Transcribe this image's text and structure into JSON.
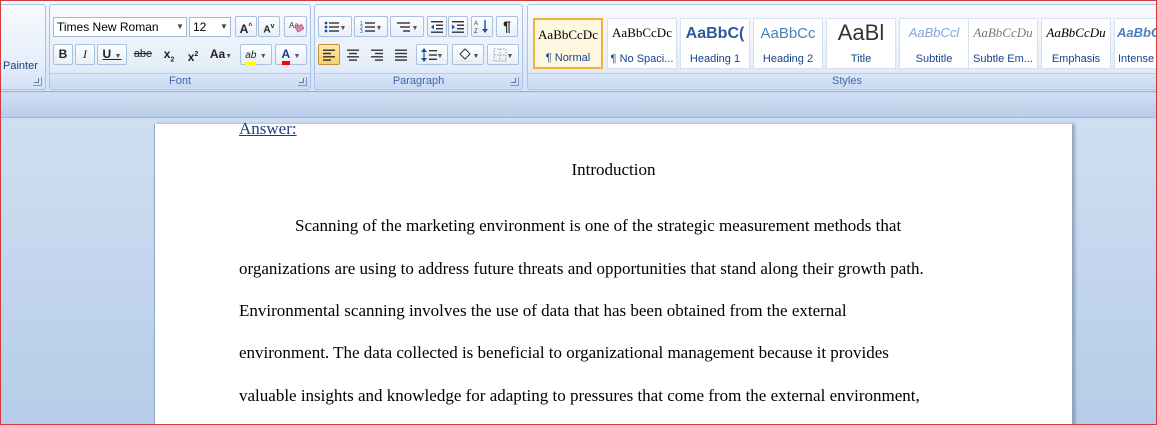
{
  "ribbon": {
    "clipboard": {
      "painter_label": "Painter"
    },
    "font": {
      "group_label": "Font",
      "font_name": "Times New Roman",
      "font_size": "12",
      "grow_label": "A",
      "shrink_label": "A",
      "bold_label": "B",
      "italic_label": "I",
      "underline_label": "U",
      "strike_label": "abe",
      "subscript_label": "x",
      "superscript_label": "x",
      "case_label": "Aa",
      "highlight_label": "ab",
      "fontcolor_label": "A",
      "highlight_color": "#ffff00",
      "fontcolor_color": "#ff0000"
    },
    "paragraph": {
      "group_label": "Paragraph"
    },
    "styles": {
      "group_label": "Styles",
      "items": [
        {
          "sample": "AaBbCcDc",
          "name": "¶ Normal"
        },
        {
          "sample": "AaBbCcDc",
          "name": "¶ No Spaci..."
        },
        {
          "sample": "AaBbC(",
          "name": "Heading 1"
        },
        {
          "sample": "AaBbCc",
          "name": "Heading 2"
        },
        {
          "sample": "AaBl",
          "name": "Title"
        },
        {
          "sample": "AaBbCcl",
          "name": "Subtitle"
        },
        {
          "sample": "AaBbCcDu",
          "name": "Subtle Em..."
        },
        {
          "sample": "AaBbCcDu",
          "name": "Emphasis"
        },
        {
          "sample": "AaBbC",
          "name": "Intense"
        }
      ]
    }
  },
  "document": {
    "answer_label": "Answer:",
    "title": "Introduction",
    "lines": [
      "Scanning of the marketing environment is one of the strategic  measurement methods that",
      "organizations are using to address future threats and opportunities that stand along their growth path.",
      "Environmental scanning involves the use of data that has been obtained from the external",
      "environment. The data collected is beneficial to organizational management because it provides",
      "valuable insights and knowledge for adapting to pressures that come from the external environment,"
    ]
  }
}
